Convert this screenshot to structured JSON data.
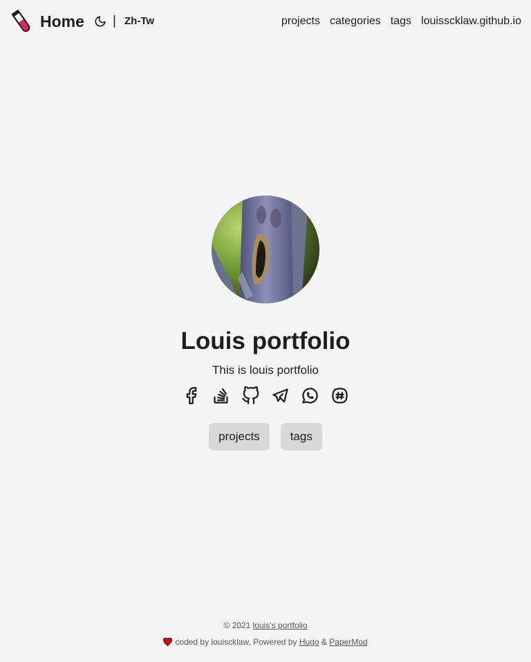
{
  "header": {
    "logo_icon": "test-tube-icon",
    "home_label": "Home",
    "theme_icon": "moon-icon",
    "separator": "|",
    "lang_label": "Zh-Tw",
    "nav": [
      {
        "label": "projects"
      },
      {
        "label": "categories"
      },
      {
        "label": "tags"
      },
      {
        "label": "louisscklaw.github.io"
      }
    ]
  },
  "profile": {
    "title": "Louis portfolio",
    "subtitle": "This is louis portfolio",
    "social_icons": [
      "facebook-icon",
      "stackoverflow-icon",
      "github-icon",
      "telegram-icon",
      "whatsapp-icon",
      "slack-icon"
    ],
    "buttons": [
      {
        "label": "projects"
      },
      {
        "label": "tags"
      }
    ]
  },
  "footer": {
    "copyright": "© 2021",
    "site_link": "louis's portfolio",
    "coded_by": "coded by louiscklaw, Powered by",
    "hugo_link": "Hugo",
    "amp": "&",
    "papermod_link": "PaperMod"
  },
  "colors": {
    "background": "#f5f5f5",
    "text": "#1e1e1e",
    "button_bg": "#d8d8d8",
    "heart": "#d0021b"
  }
}
